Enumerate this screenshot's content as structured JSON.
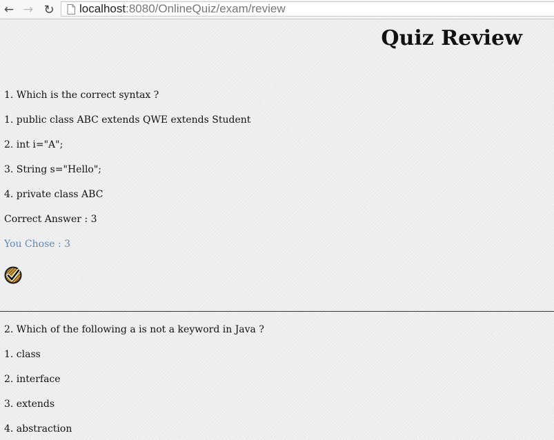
{
  "browser": {
    "url_host": "localhost",
    "url_path": ":8080/OnlineQuiz/exam/review",
    "icons": [
      "back-arrow-icon",
      "forward-arrow-icon",
      "reload-icon",
      "page-icon"
    ]
  },
  "page": {
    "title": "Quiz Review"
  },
  "questions": [
    {
      "question": "1. Which is the correct syntax ?",
      "options": [
        "1. public class ABC extends QWE extends Student",
        "2. int i=\"A\";",
        "3. String s=\"Hello\";",
        "4. private class ABC"
      ],
      "correct": "Correct Answer : 3",
      "chosen": "You Chose : 3",
      "result_icon": "checkmark-icon"
    },
    {
      "question": "2. Which of the following a is not a keyword in Java ?",
      "options": [
        "1. class",
        "2. interface",
        "3. extends",
        "4. abstraction"
      ]
    }
  ],
  "colors": {
    "chosen_text": "#5a86b8",
    "background": "#ececec"
  }
}
